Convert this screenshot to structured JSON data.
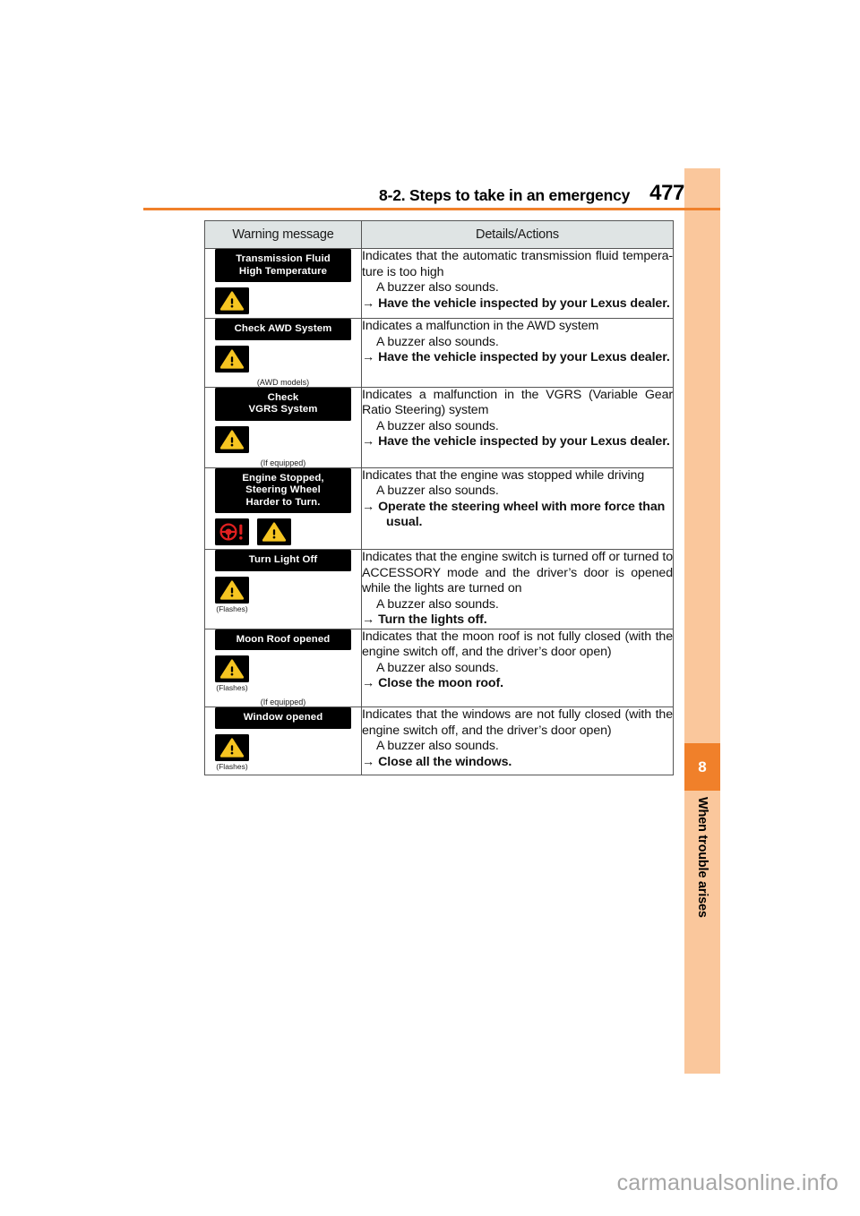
{
  "header": {
    "title": "8-2. Steps to take in an emergency",
    "page_number": "477",
    "rule_color": "#f0802a"
  },
  "sidebar": {
    "chapter_number": "8",
    "chapter_name": "When trouble arises",
    "band_color": "#fac79c",
    "tab_color": "#f0802a"
  },
  "table": {
    "columns": [
      "Warning message",
      "Details/Actions"
    ],
    "rows": [
      {
        "display_lines": [
          "Transmission Fluid",
          "High Temperature"
        ],
        "icons": [
          "warning-triangle-icon"
        ],
        "icon_notes": [
          ""
        ],
        "caption": "",
        "details": {
          "line1": "Indicates that the automatic transmission fluid tempera-ture is too high",
          "line2": "A buzzer also sounds.",
          "arrow": "→",
          "action": "Have the vehicle inspected by your Lexus dealer.",
          "action_cont": ""
        }
      },
      {
        "display_lines": [
          "Check  AWD System"
        ],
        "icons": [
          "warning-triangle-icon"
        ],
        "icon_notes": [
          ""
        ],
        "caption": "(AWD models)",
        "details": {
          "line1": "Indicates a malfunction in the AWD system",
          "line2": "A buzzer also sounds.",
          "arrow": "→",
          "action": "Have the vehicle inspected by your Lexus dealer.",
          "action_cont": ""
        }
      },
      {
        "display_lines": [
          "Check",
          "VGRS System"
        ],
        "icons": [
          "warning-triangle-icon"
        ],
        "icon_notes": [
          ""
        ],
        "caption": "(If equipped)",
        "details": {
          "line1": "Indicates a malfunction in the VGRS (Variable Gear Ratio Steering) system",
          "line2": "A buzzer also sounds.",
          "arrow": "→",
          "action": "Have the vehicle inspected by your Lexus dealer.",
          "action_cont": ""
        }
      },
      {
        "display_lines": [
          "Engine Stopped,",
          "Steering Wheel",
          "Harder to Turn."
        ],
        "icons": [
          "steering-wheel-warning-icon",
          "warning-triangle-icon"
        ],
        "icon_notes": [
          "",
          ""
        ],
        "caption": "",
        "details": {
          "line1": "Indicates that the engine was stopped while driving",
          "line2": "A buzzer also sounds.",
          "arrow": "→",
          "action": "Operate the steering wheel with more force than",
          "action_cont": "usual."
        }
      },
      {
        "display_lines": [
          "Turn Light Off"
        ],
        "icons": [
          "warning-triangle-icon"
        ],
        "icon_notes": [
          "(Flashes)"
        ],
        "caption": "",
        "details": {
          "line1": "Indicates that the engine switch is turned off or turned to ACCESSORY mode and the driver’s door is opened while the lights are turned on",
          "line2": "A buzzer also sounds.",
          "arrow": "→",
          "action": "Turn the lights off.",
          "action_cont": ""
        }
      },
      {
        "display_lines": [
          "Moon Roof opened"
        ],
        "icons": [
          "warning-triangle-icon"
        ],
        "icon_notes": [
          "(Flashes)"
        ],
        "caption": "(If equipped)",
        "details": {
          "line1": "Indicates that the moon roof is not fully closed (with the engine switch off, and the driver’s door open)",
          "line2": "A buzzer also sounds.",
          "arrow": "→",
          "action": "Close the moon roof.",
          "action_cont": ""
        }
      },
      {
        "display_lines": [
          "Window opened"
        ],
        "icons": [
          "warning-triangle-icon"
        ],
        "icon_notes": [
          "(Flashes)"
        ],
        "caption": "",
        "details": {
          "line1": "Indicates that the windows are not fully closed (with the engine switch off, and the driver’s door open)",
          "line2": "A buzzer also sounds.",
          "arrow": "→",
          "action": "Close all the windows.",
          "action_cont": ""
        }
      }
    ]
  },
  "watermark": "carmanualsonline.info"
}
